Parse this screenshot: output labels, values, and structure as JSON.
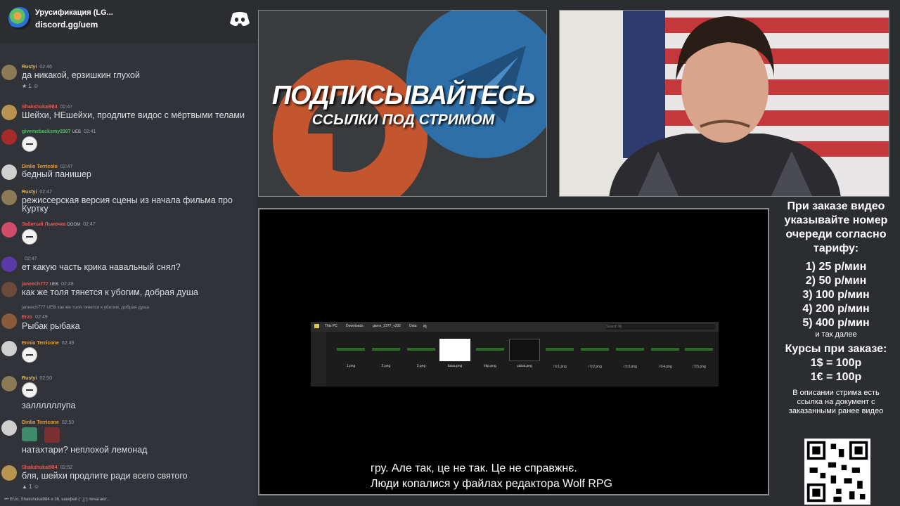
{
  "chat": {
    "server_name": "Урусификация (LG...",
    "server_invite": "discord.gg/uem",
    "messages": [
      {
        "user": "Rustyi",
        "badge": "",
        "time": "02:46",
        "text": "да никакой, ерзишкин глухой",
        "reaction": "1",
        "color": "#e9b84a"
      },
      {
        "user": "Shakshukai984",
        "badge": "",
        "time": "02:47",
        "text": "Шейхи, НЕшейхи, продлите видос с мёртвыми телами",
        "color": "#e65b5b"
      },
      {
        "user": "givemebacksmy2007",
        "badge": "UEB",
        "time": "02:41",
        "text": "",
        "color": "#4fbf63"
      },
      {
        "user": "Dinlio Terricolo",
        "badge": "",
        "time": "02:47",
        "text": "бедный панишер",
        "color": "#e6a23a"
      },
      {
        "user": "Rustyi",
        "badge": "",
        "time": "02:47",
        "text": "режиссерская версия сцены из начала фильма про Куртку",
        "color": "#e9b84a"
      },
      {
        "user": "Забитый Льмочка",
        "badge": "DOOM",
        "time": "02:47",
        "text": "",
        "color": "#e65b5b"
      },
      {
        "user": "",
        "badge": "",
        "time": "02:47",
        "text": "ет какую часть крика навальный снял?",
        "color": "#b5bac1"
      },
      {
        "user": "janeech777",
        "badge": "UEB",
        "time": "02:48",
        "text": "как же толя тянется к убогим, добрая душа",
        "color": "#e65b5b"
      },
      {
        "user": "Erzo",
        "badge": "",
        "time": "02:49",
        "text": "Рыбак рыбака",
        "reply": "janeech777 UEB как же толя тянется к убогим, добрая душа",
        "color": "#e65b5b"
      },
      {
        "user": "Ennio Terricone",
        "badge": "",
        "time": "02:49",
        "text": "",
        "color": "#e6a23a"
      },
      {
        "user": "Rustyi",
        "badge": "",
        "time": "02:50",
        "text": "заллллллупа",
        "color": "#e9b84a"
      },
      {
        "user": "Dinlio Terricone",
        "badge": "",
        "time": "02:50",
        "text": "натахтари? неплохой лемонад",
        "color": "#e6a23a"
      },
      {
        "user": "Shakshukai984",
        "badge": "",
        "time": "02:52",
        "text": "бля, шейхи продлите ради всего святого",
        "reaction": "1",
        "color": "#e65b5b"
      }
    ],
    "typing": "Erzo, Shakshukai984 и 36, шакфей (ᵔ ͜ʖᵔ) печатают..."
  },
  "promo": {
    "title": "ПОДПИСЫВАЙТЕСЬ",
    "subtitle": "ССЫЛКИ ПОД СТРИМОМ"
  },
  "video": {
    "explorer": {
      "breadcrumbs": [
        "This PC",
        "Downloads",
        "game_2377_v202",
        "Data",
        "哈"
      ],
      "search_placeholder": "Search 哈",
      "files": [
        {
          "name": "1.png",
          "kind": "green"
        },
        {
          "name": "2.png",
          "kind": "green"
        },
        {
          "name": "3.png",
          "kind": "green"
        },
        {
          "name": "basa.png",
          "kind": "white"
        },
        {
          "name": "kkp.png",
          "kind": "green"
        },
        {
          "name": "yabai.png",
          "kind": "dark"
        },
        {
          "name": "ﾉ①1.png",
          "kind": "green"
        },
        {
          "name": "ﾉ①2.png",
          "kind": "green"
        },
        {
          "name": "ﾉ①3.png",
          "kind": "green"
        },
        {
          "name": "ﾉ①4.png",
          "kind": "green"
        },
        {
          "name": "ﾉ①5.png",
          "kind": "green"
        }
      ]
    },
    "subtitle_line1": "гру.  Але так, це не так.  Це не справжнє.",
    "subtitle_line2": "Люди копалися у файлах редактора Wolf RPG"
  },
  "info": {
    "heading": "При заказе видео указывайте номер очереди согласно тарифу:",
    "tiers": [
      "1) 25 р/мин",
      "2) 50 р/мин",
      "3) 100 р/мин",
      "4) 200 р/мин",
      "5) 400 р/мин"
    ],
    "etc": "и так далее",
    "rates_heading": "Курсы при заказе:",
    "rates": [
      "1$ = 100р",
      "1€ = 100р"
    ],
    "note": "В описании стрима есть ссылка на документ с заказанными ранее видео"
  },
  "colors": {
    "discord_bg": "#313338",
    "promo_orange": "#c4562f",
    "promo_blue": "#2f6fa8"
  }
}
